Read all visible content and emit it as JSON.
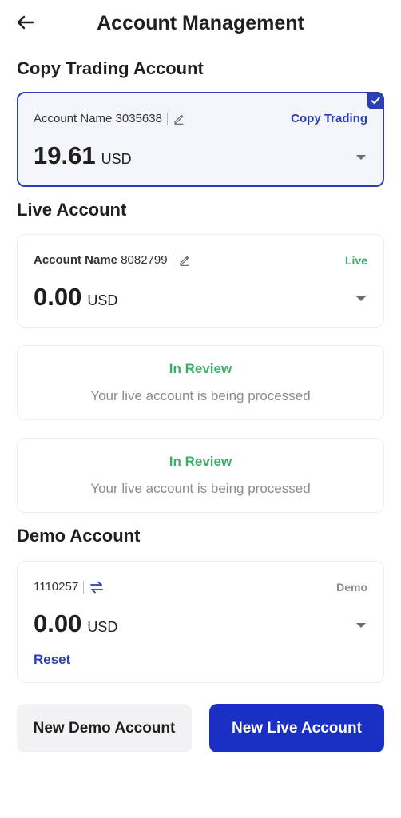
{
  "header": {
    "title": "Account Management",
    "back_icon": "arrow-left-icon"
  },
  "copy_section": {
    "title": "Copy Trading Account",
    "card": {
      "name_label": "Account Name",
      "account_id": "3035638",
      "type_label": "Copy Trading",
      "type_color": "#2a3fb4",
      "balance": "19.61",
      "currency": "USD",
      "selected": true
    }
  },
  "live_section": {
    "title": "Live Account",
    "card": {
      "name_label": "Account Name",
      "account_id": "8082799",
      "type_label": "Live",
      "type_color": "#3dae6a",
      "balance": "0.00",
      "currency": "USD"
    },
    "reviews": [
      {
        "status": "In Review",
        "message": "Your live account is being processed"
      },
      {
        "status": "In Review",
        "message": "Your live account is being processed"
      }
    ]
  },
  "demo_section": {
    "title": "Demo Account",
    "card": {
      "account_id": "1110257",
      "type_label": "Demo",
      "balance": "0.00",
      "currency": "USD",
      "reset_label": "Reset"
    }
  },
  "actions": {
    "new_demo_label": "New Demo Account",
    "new_live_label": "New Live Account"
  },
  "colors": {
    "accent": "#2a3fb4",
    "primary_button": "#1a2fc4",
    "success": "#3dae6a"
  }
}
